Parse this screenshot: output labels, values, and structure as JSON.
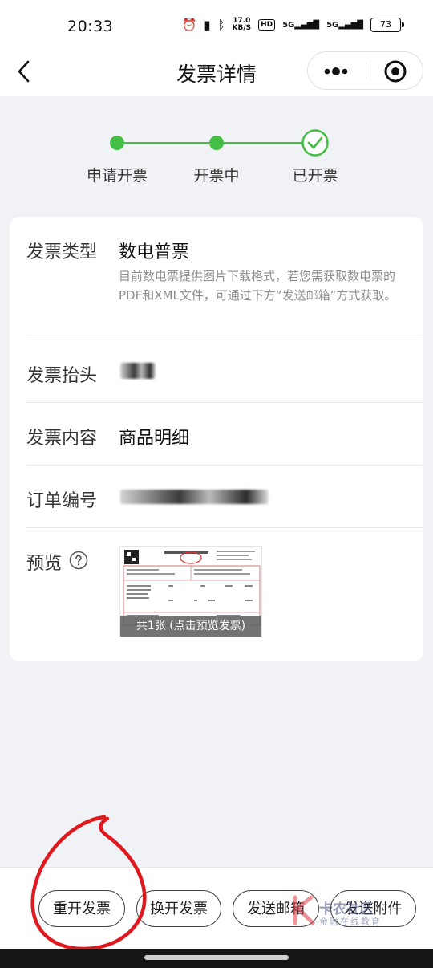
{
  "status_bar": {
    "time": "20:33",
    "speed_top": "17.0",
    "speed_unit": "KB/S",
    "hd_label": "HD",
    "signal1": "5G",
    "signal2": "5G",
    "battery": "73",
    "icons": [
      "alarm-icon",
      "vibrate-icon",
      "bluetooth-icon",
      "hd-icon",
      "signal-icon",
      "signal-icon",
      "battery-icon"
    ]
  },
  "nav": {
    "title": "发票详情",
    "back_icon": "chevron-left-icon",
    "more_icon": "more-dots-icon",
    "close_icon": "target-close-icon"
  },
  "progress": {
    "steps": [
      {
        "label": "申请开票",
        "state": "done"
      },
      {
        "label": "开票中",
        "state": "done"
      },
      {
        "label": "已开票",
        "state": "current"
      }
    ],
    "accent": "#44be45"
  },
  "details": {
    "invoice_type_label": "发票类型",
    "invoice_type_value": "数电普票",
    "invoice_type_note": "目前数电票提供图片下载格式，若您需获取数电票的PDF和XML文件，可通过下方“发送邮箱”方式获取。",
    "title_label": "发票抬头",
    "content_label": "发票内容",
    "content_value": "商品明细",
    "order_label": "订单编号",
    "preview_label": "预览",
    "preview_caption": "共1张 (点击预览发票)"
  },
  "actions": {
    "reissue": "重开发票",
    "exchange": "换开发票",
    "send_email": "发送邮箱",
    "send_attachment": "发送附件"
  },
  "watermark": {
    "brand": "卡农社区",
    "sub": "金融在线教育"
  }
}
